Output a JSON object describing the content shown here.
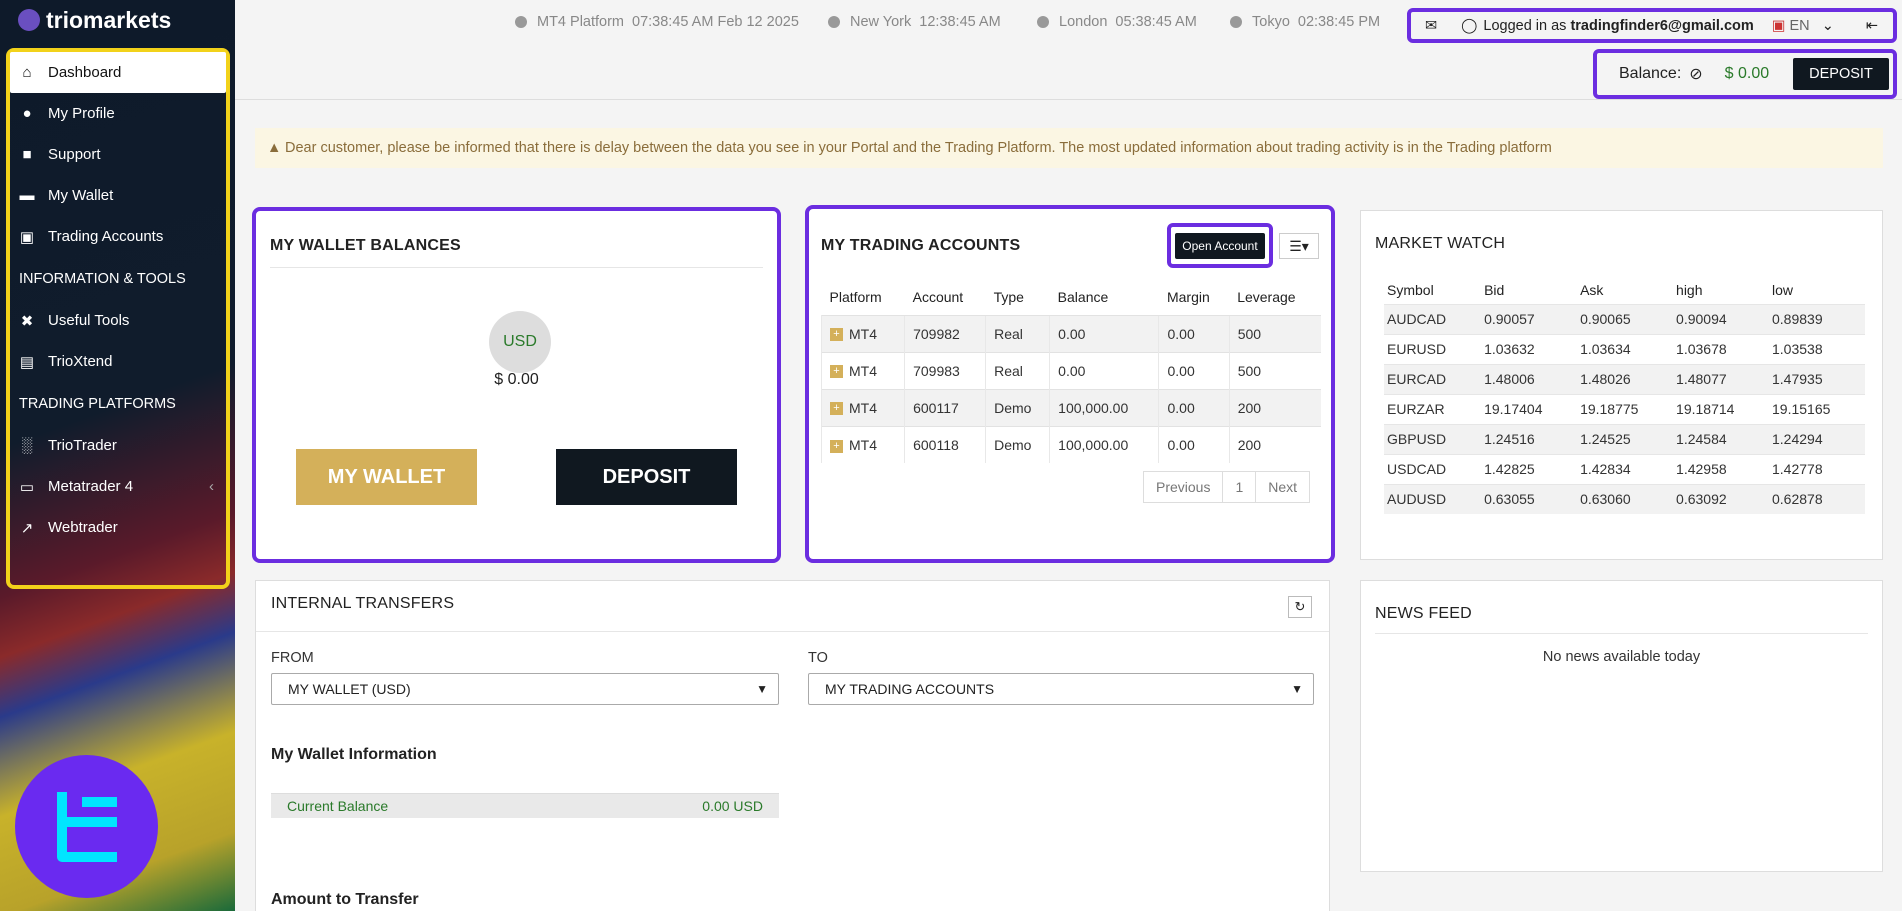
{
  "brand": {
    "name": "triomarkets"
  },
  "sidebar": {
    "items": [
      {
        "label": "Dashboard",
        "icon": "home-icon"
      },
      {
        "label": "My Profile",
        "icon": "user-icon"
      },
      {
        "label": "Support",
        "icon": "chat-icon"
      },
      {
        "label": "My Wallet",
        "icon": "folder-icon"
      },
      {
        "label": "Trading Accounts",
        "icon": "briefcase-icon"
      }
    ],
    "section_info": "INFORMATION & TOOLS",
    "tools": [
      {
        "label": "Useful Tools",
        "icon": "tools-icon"
      },
      {
        "label": "TrioXtend",
        "icon": "file-icon"
      }
    ],
    "section_platforms": "TRADING PLATFORMS",
    "platforms": [
      {
        "label": "TrioTrader",
        "icon": "bar-chart-icon"
      },
      {
        "label": "Metatrader 4",
        "icon": "laptop-icon"
      },
      {
        "label": "Webtrader",
        "icon": "line-chart-icon"
      }
    ]
  },
  "topbar": {
    "clocks": [
      {
        "label": "MT4 Platform",
        "time": "07:38:45 AM  Feb 12 2025"
      },
      {
        "label": "New York",
        "time": "12:38:45 AM"
      },
      {
        "label": "London",
        "time": "05:38:45 AM"
      },
      {
        "label": "Tokyo",
        "time": "02:38:45 PM"
      }
    ],
    "logged_in_prefix": "Logged in as",
    "user_email": "tradingfinder6@gmail.com",
    "language": "EN",
    "balance_label": "Balance:",
    "balance_value": "$ 0.00",
    "deposit_label": "DEPOSIT"
  },
  "notice": "Dear customer, please be informed that there is delay between the data you see in your Portal and the Trading Platform. The most updated information about trading activity is in the Trading platform",
  "wallet": {
    "title": "MY WALLET BALANCES",
    "currency": "USD",
    "balance": "$ 0.00",
    "my_wallet_button": "MY WALLET",
    "deposit_button": "DEPOSIT"
  },
  "trading": {
    "title": "MY TRADING ACCOUNTS",
    "open_account_label": "Open Account",
    "columns": [
      "Platform",
      "Account",
      "Type",
      "Balance",
      "Margin",
      "Leverage"
    ],
    "rows": [
      [
        "MT4",
        "709982",
        "Real",
        "0.00",
        "0.00",
        "500"
      ],
      [
        "MT4",
        "709983",
        "Real",
        "0.00",
        "0.00",
        "500"
      ],
      [
        "MT4",
        "600117",
        "Demo",
        "100,000.00",
        "0.00",
        "200"
      ],
      [
        "MT4",
        "600118",
        "Demo",
        "100,000.00",
        "0.00",
        "200"
      ]
    ],
    "pager": {
      "previous": "Previous",
      "page": "1",
      "next": "Next"
    }
  },
  "market": {
    "title": "MARKET WATCH",
    "columns": [
      "Symbol",
      "Bid",
      "Ask",
      "high",
      "low"
    ],
    "rows": [
      [
        "AUDCAD",
        "0.90057",
        "0.90065",
        "0.90094",
        "0.89839"
      ],
      [
        "EURUSD",
        "1.03632",
        "1.03634",
        "1.03678",
        "1.03538"
      ],
      [
        "EURCAD",
        "1.48006",
        "1.48026",
        "1.48077",
        "1.47935"
      ],
      [
        "EURZAR",
        "19.17404",
        "19.18775",
        "19.18714",
        "19.15165"
      ],
      [
        "GBPUSD",
        "1.24516",
        "1.24525",
        "1.24584",
        "1.24294"
      ],
      [
        "USDCAD",
        "1.42825",
        "1.42834",
        "1.42958",
        "1.42778"
      ],
      [
        "AUDUSD",
        "0.63055",
        "0.63060",
        "0.63092",
        "0.62878"
      ]
    ]
  },
  "transfers": {
    "title": "INTERNAL TRANSFERS",
    "from_label": "FROM",
    "from_value": "MY WALLET (USD)",
    "to_label": "TO",
    "to_value": "MY TRADING ACCOUNTS",
    "wallet_info_title": "My Wallet Information",
    "current_balance_label": "Current Balance",
    "current_balance_value": "0.00 USD",
    "amount_title": "Amount to Transfer"
  },
  "news": {
    "title": "NEWS FEED",
    "empty": "No news available today"
  },
  "colors": {
    "highlight_purple": "#6b2de0",
    "highlight_yellow": "#f2d21a",
    "gold": "#d4b05a",
    "dark": "#101820",
    "positive": "#2a7a2a"
  }
}
